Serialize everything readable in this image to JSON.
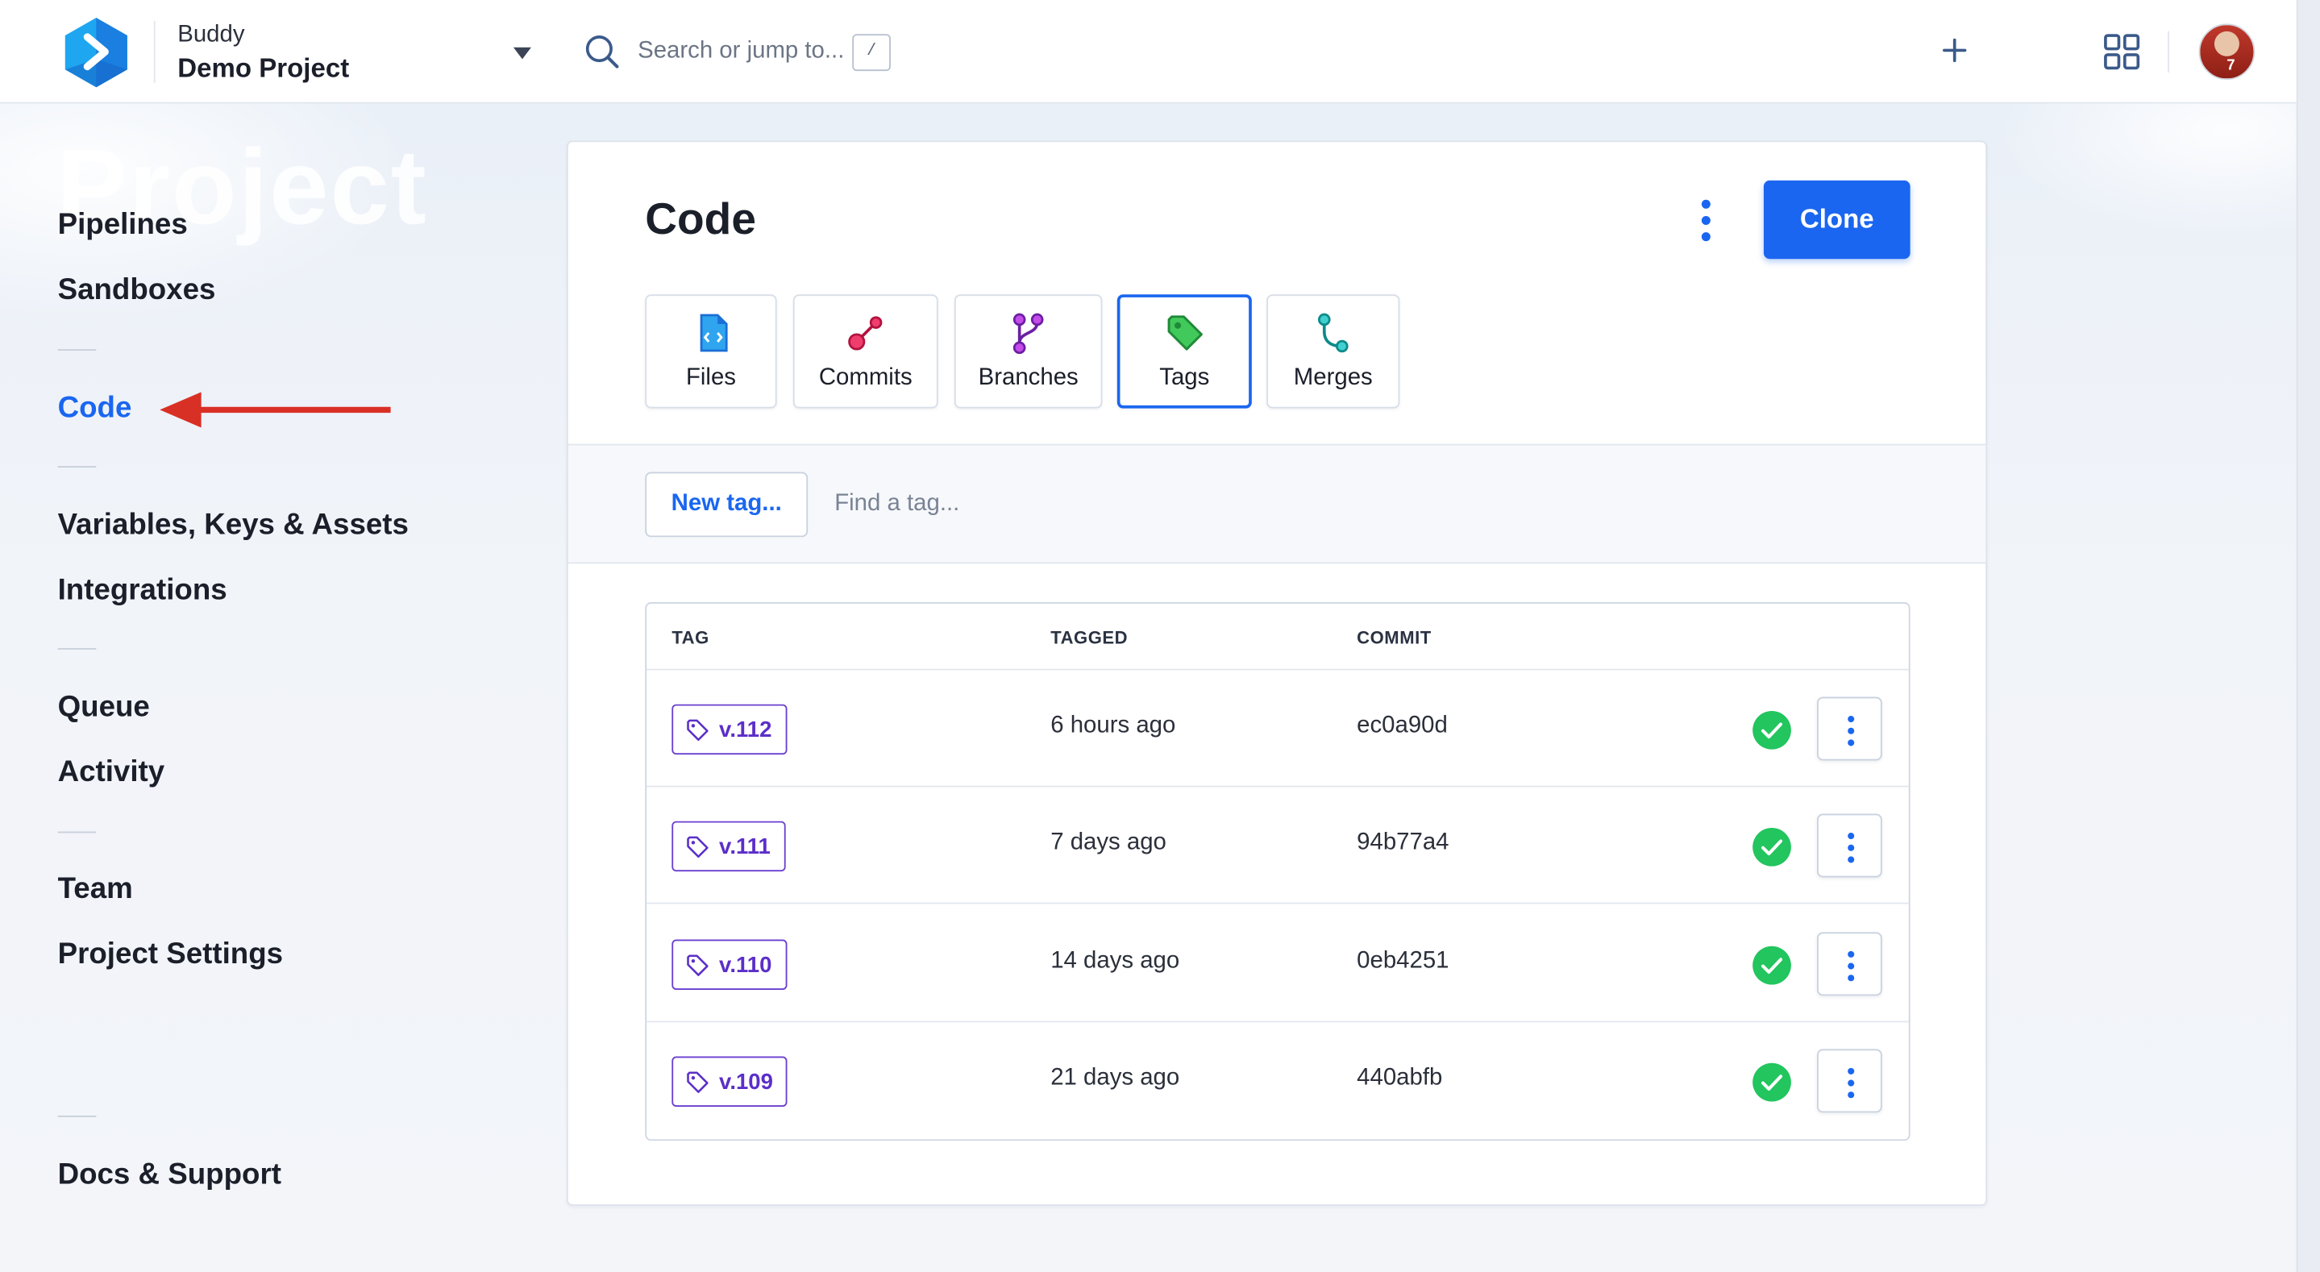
{
  "header": {
    "org": "Buddy",
    "project": "Demo Project",
    "search_placeholder": "Search or jump to...",
    "search_shortcut": "/",
    "brand_color": "#1a66f0"
  },
  "sidebar": {
    "watermark": "Project",
    "items": [
      {
        "label": "Pipelines"
      },
      {
        "label": "Sandboxes"
      },
      {
        "label": "Code",
        "active": true
      },
      {
        "label": "Variables, Keys & Assets"
      },
      {
        "label": "Integrations"
      },
      {
        "label": "Queue"
      },
      {
        "label": "Activity"
      },
      {
        "label": "Team"
      },
      {
        "label": "Project Settings"
      },
      {
        "label": "Docs & Support"
      }
    ]
  },
  "main": {
    "title": "Code",
    "clone_label": "Clone",
    "tabs": [
      {
        "label": "Files",
        "icon": "file-code-icon"
      },
      {
        "label": "Commits",
        "icon": "commit-icon"
      },
      {
        "label": "Branches",
        "icon": "branch-icon"
      },
      {
        "label": "Tags",
        "icon": "tag-icon",
        "active": true
      },
      {
        "label": "Merges",
        "icon": "merge-icon"
      }
    ],
    "new_tag_label": "New tag...",
    "find_placeholder": "Find a tag...",
    "table": {
      "columns": [
        "TAG",
        "TAGGED",
        "COMMIT"
      ],
      "rows": [
        {
          "tag": "v.112",
          "tagged": "6 hours ago",
          "commit": "ec0a90d",
          "status": "success"
        },
        {
          "tag": "v.111",
          "tagged": "7 days ago",
          "commit": "94b77a4",
          "status": "success"
        },
        {
          "tag": "v.110",
          "tagged": "14 days ago",
          "commit": "0eb4251",
          "status": "success"
        },
        {
          "tag": "v.109",
          "tagged": "21 days ago",
          "commit": "440abfb",
          "status": "success"
        }
      ]
    }
  },
  "colors": {
    "accent": "#1a66f0",
    "success": "#22c55e",
    "tag_purple": "#5b2fc9",
    "annotation_arrow": "#d93025"
  }
}
